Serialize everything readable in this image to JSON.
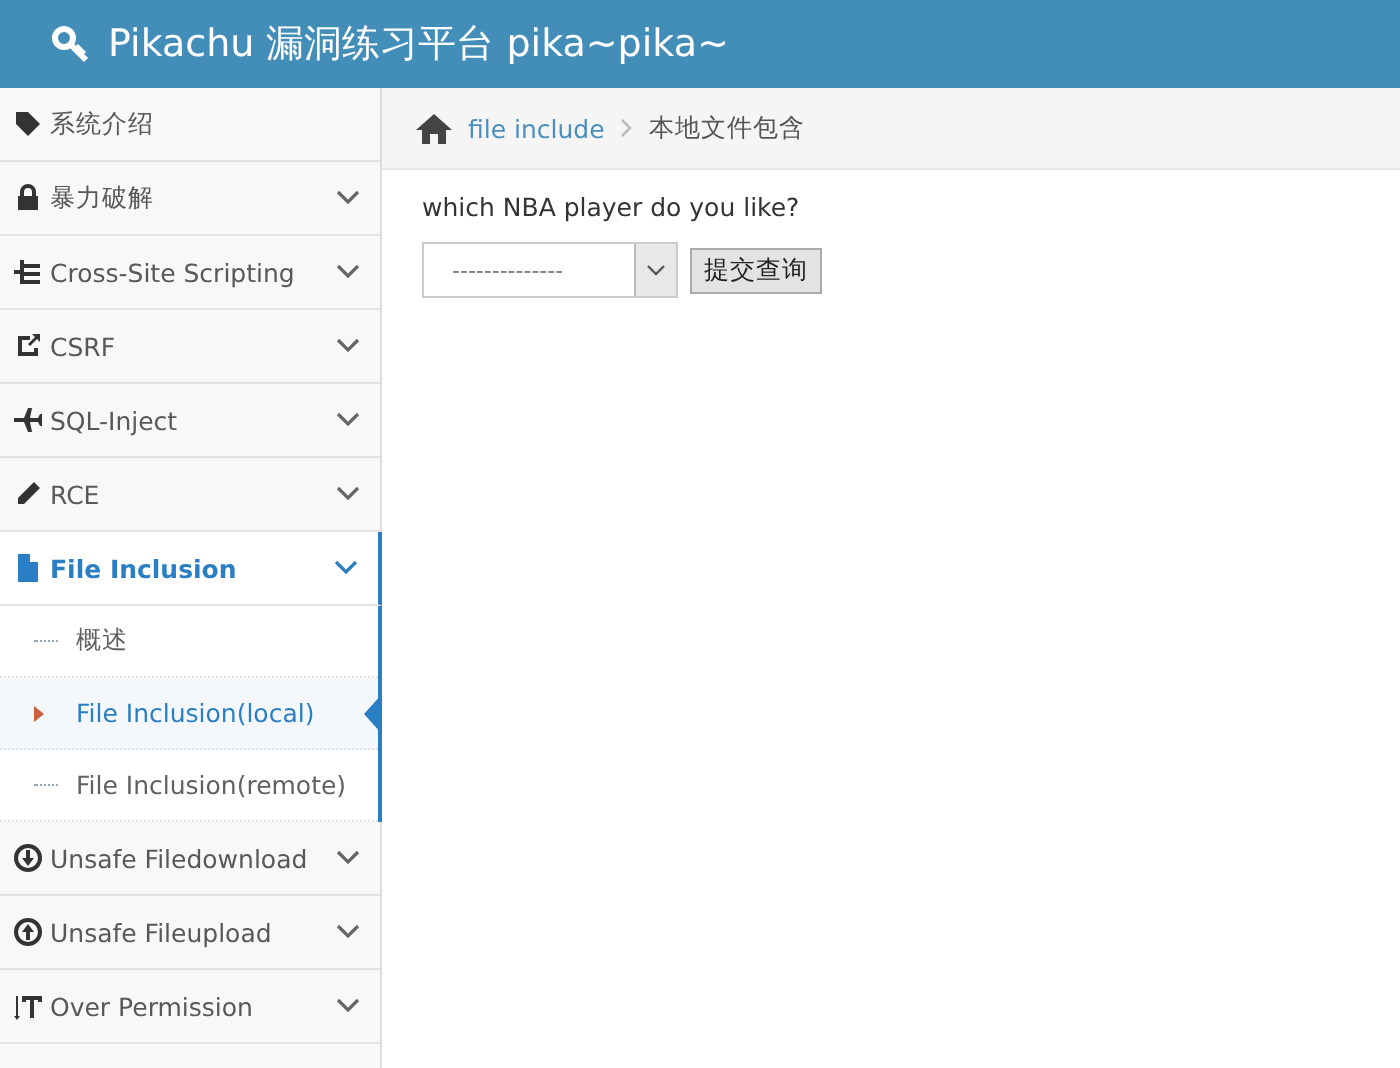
{
  "header": {
    "title": "Pikachu 漏洞练习平台 pika~pika~"
  },
  "sidebar": {
    "items": [
      {
        "label": "系统介绍",
        "expandable": false,
        "selected": false
      },
      {
        "label": "暴力破解",
        "expandable": true,
        "selected": false
      },
      {
        "label": "Cross-Site Scripting",
        "expandable": true,
        "selected": false
      },
      {
        "label": "CSRF",
        "expandable": true,
        "selected": false
      },
      {
        "label": "SQL-Inject",
        "expandable": true,
        "selected": false
      },
      {
        "label": "RCE",
        "expandable": true,
        "selected": false
      },
      {
        "label": "File Inclusion",
        "expandable": true,
        "selected": true,
        "children": [
          {
            "label": "概述",
            "selected": false
          },
          {
            "label": "File Inclusion(local)",
            "selected": true
          },
          {
            "label": "File Inclusion(remote)",
            "selected": false
          }
        ]
      },
      {
        "label": "Unsafe Filedownload",
        "expandable": true,
        "selected": false
      },
      {
        "label": "Unsafe Fileupload",
        "expandable": true,
        "selected": false
      },
      {
        "label": "Over Permission",
        "expandable": true,
        "selected": false
      }
    ]
  },
  "breadcrumb": [
    {
      "label": "file include",
      "kind": "link"
    },
    {
      "label": "本地文件包含",
      "kind": "current"
    }
  ],
  "form": {
    "question": "which NBA player do you like?",
    "select_value": "--------------",
    "submit": "提交查询"
  }
}
